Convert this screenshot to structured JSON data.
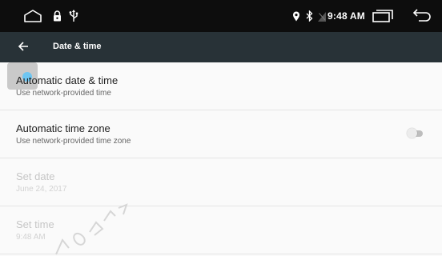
{
  "status_bar": {
    "time": "9:48 AM",
    "icons": [
      "home-icon",
      "lock-icon",
      "usb-icon",
      "location-icon",
      "bluetooth-icon",
      "signal-icon",
      "recents-icon",
      "back-icon"
    ]
  },
  "app_bar": {
    "title": "Date & time",
    "back_icon": "arrow-back-icon",
    "background": "#283237"
  },
  "settings": {
    "items": [
      {
        "title": "Automatic date & time",
        "summary": "Use network-provided time",
        "enabled": true
      },
      {
        "title": "Automatic time zone",
        "summary": "Use network-provided time zone",
        "enabled": true,
        "toggle": false
      },
      {
        "title": "Set date",
        "summary": "June 24, 2017",
        "enabled": false
      },
      {
        "title": "Set time",
        "summary": "9:48 AM",
        "enabled": false
      }
    ]
  },
  "colors": {
    "status_bar": "#0d0d0d",
    "accent_ripple": "#6ec6f2",
    "list_background": "#fafafa"
  }
}
